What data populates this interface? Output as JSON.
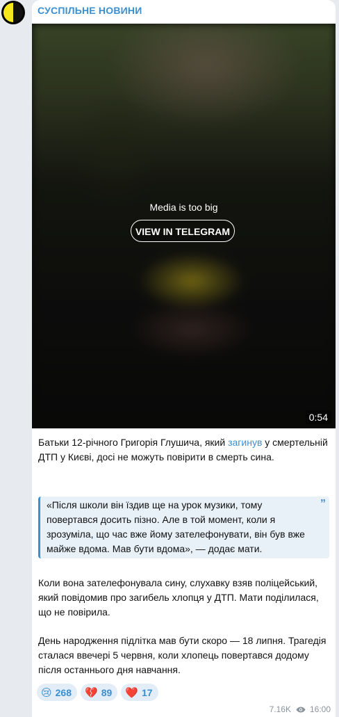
{
  "channel": {
    "name": "СУСПІЛЬНЕ НОВИНИ"
  },
  "media": {
    "message": "Media is too big",
    "button_label": "VIEW IN TELEGRAM",
    "duration": "0:54"
  },
  "post": {
    "p1_before": "Батьки 12-річного Григорія Глушича, який ",
    "p1_link": "загинув",
    "p1_after": " у смертельній ДТП у Києві, досі не можуть повірити в смерть сина.",
    "quote": "«Після школи він їздив ще на урок музики, тому повертався досить пізно. Але в той момент, коли я зрозуміла, що час вже йому зателефонувати, він був вже майже вдома. Мав бути вдома», — додає мати.",
    "quote_mark": "”",
    "p2": "Коли вона зателефонувала сину, слухавку взяв поліцейський, який повідомив про загибель хлопця у ДТП. Мати поділилася, що не повірила.",
    "p3": "День народження підлітка мав бути скоро — 18 липня. Трагедія сталася ввечері 5 червня, коли хлопець повертався додому після останнього дня навчання."
  },
  "reactions": [
    {
      "emoji": "😢",
      "count": "268"
    },
    {
      "emoji": "💔",
      "count": "89"
    },
    {
      "emoji": "❤️",
      "count": "17"
    }
  ],
  "meta": {
    "views": "7.16K",
    "time": "16:00",
    "views_icon": "eye-icon"
  },
  "colors": {
    "accent": "#3a8fd1",
    "background": "#e7ebf0",
    "quote_bg": "#e9f1f8"
  }
}
